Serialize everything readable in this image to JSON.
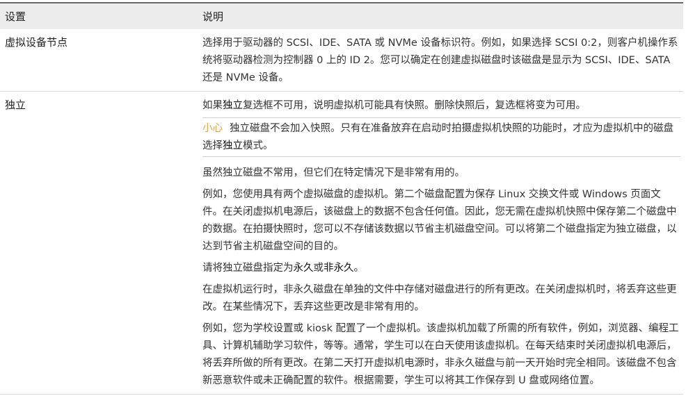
{
  "header": {
    "col_setting": "设置",
    "col_description": "说明"
  },
  "rows": [
    {
      "setting": "虚拟设备节点",
      "text": "选择用于驱动器的 SCSI、IDE、SATA 或 NVMe 设备标识符。例如，如果选择 SCSI 0:2，则客户机操作系统将驱动器检测为控制器 0 上的 ID 2。您可以确定在创建虚拟磁盘时该磁盘是显示为 SCSI、IDE、SATA 还是 NVMe 设备。"
    },
    {
      "setting": "独立",
      "intro_a": "如果",
      "intro_strong": "独立",
      "intro_b": "复选框不可用，说明虚拟机可能具有快照。删除快照后，复选框将变为可用。",
      "caution_label": "小心",
      "caution_a": "独立磁盘不会加入快照。只有在准备放弃在启动时拍摄虚拟机快照的功能时，才应为虚拟机中的磁盘选择",
      "caution_strong": "独立",
      "caution_b": "模式。",
      "p1": "虽然独立磁盘不常用，但它们在特定情况下是非常有用的。",
      "p2": "例如，您使用具有两个虚拟磁盘的虚拟机。第二个磁盘配置为保存 Linux 交换文件或 Windows 页面文件。在关闭虚拟机电源后，该磁盘上的数据不包含任何值。因此，您无需在虚拟机快照中保存第二个磁盘中的数据。在拍摄快照时，您可以不存储该数据以节省主机磁盘空间。可以将第二个磁盘指定为独立磁盘，以达到节省主机磁盘空间的目的。",
      "p3_a": "请将独立磁盘指定为",
      "p3_strong1": "永久",
      "p3_mid": "或",
      "p3_strong2": "非永久",
      "p3_b": "。",
      "p4": "在虚拟机运行时，非永久磁盘在单独的文件中存储对磁盘进行的所有更改。在关闭虚拟机时，将丢弃这些更改。在某些情况下，丢弃这些更改是非常有用的。",
      "p5": "例如，您为学校设置或 kiosk 配置了一个虚拟机。该虚拟机加载了所需的所有软件，例如，浏览器、编程工具、计算机辅助学习软件，等等。通常，学生可以在白天使用该虚拟机。在每天结束时关闭虚拟机电源后，将丢弃所做的所有更改。在第二天打开虚拟机电源时，非永久磁盘与前一天开始时完全相同。该磁盘不包含新恶意软件或未正确配置的软件。根据需要，学生可以将其工作保存到 U 盘或网络位置。"
    }
  ]
}
